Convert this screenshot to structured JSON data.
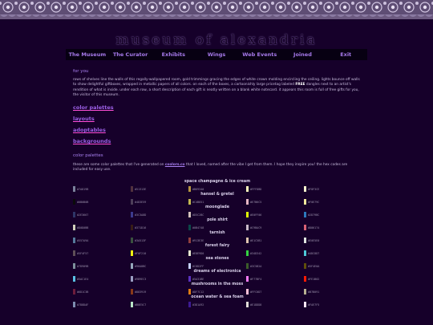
{
  "title": "museum of alexandria",
  "nav": [
    "The Museum",
    "The Curator",
    "Exhibits",
    "Wings",
    "Web Events",
    "Joined",
    "Exit"
  ],
  "intro": {
    "heading": "for you",
    "p1": "rows of shelves line the walls of this regally-wallpapered room, gold trimmings gracing the edges of white crown molding encircling the ceiling. lights bounce off walls to show delightful giftboxes, wrapped in metallic papers of all colors. on each of the boxes, a cartoonishly large pricetag labeled",
    "free": "FREE",
    "p2": "dangles next to an artist's rendition of what is inside. under each row, a short description of each gift is neatly written on a blank white notecard. it appears this room is full of free gifts for you, the visitor of this museum."
  },
  "links": [
    "color palettes",
    "layouts",
    "adoptables",
    "backgrounds"
  ],
  "palettes_section": {
    "heading": "color palettes",
    "text_a": "these are some color palettes that I've generated on",
    "link": "coolors.co",
    "text_b": "that I loved, named after the vibe I get from them. I hope they inspire you! the hex codes are included for easy use."
  },
  "palette_names": [
    "space champagne & ice cream",
    "hansel & gretel",
    "moonglade",
    "pole shirt",
    "tarnish",
    "forest fairy",
    "sea stones",
    "dreams of electronica",
    "mushrooms in the moss",
    "ocean water & sea foam"
  ],
  "swatch_rows": [
    [
      {
        "hex": "#7A819B",
        "c": "#7a819b"
      },
      {
        "hex": "#51313E",
        "c": "#51313e"
      },
      {
        "hex": "#B69340",
        "c": "#b69340"
      },
      {
        "hex": "#FFF8BD",
        "c": "#fff8bd"
      },
      {
        "hex": "#F8F3CE",
        "c": "#f8f3ce"
      }
    ],
    [
      {
        "hex": "#0B0B0B",
        "c": "#0b0b0b"
      },
      {
        "hex": "#4D3E59",
        "c": "#4d3e59"
      },
      {
        "hex": "#C4B851",
        "c": "#c4b851"
      },
      {
        "hex": "#E7B6C5",
        "c": "#e7b6c5"
      },
      {
        "hex": "#F0E79C",
        "c": "#f0e79c"
      }
    ],
    [
      {
        "hex": "#2E3667",
        "c": "#2e3667"
      },
      {
        "hex": "#3C3A8D",
        "c": "#3c3a8d"
      },
      {
        "hex": "#D5C2BC",
        "c": "#d5c2bc"
      },
      {
        "hex": "#E0FF06",
        "c": "#e0ff06"
      },
      {
        "hex": "#2D79BC",
        "c": "#2d79bc"
      }
    ],
    [
      {
        "hex": "#D0D0BB",
        "c": "#d0d0bb"
      },
      {
        "hex": "#371D16",
        "c": "#371d16"
      },
      {
        "hex": "#0B4748",
        "c": "#0b4748"
      },
      {
        "hex": "#C9BAC9",
        "c": "#c9bac9"
      },
      {
        "hex": "#D86174",
        "c": "#d86174"
      }
    ],
    [
      {
        "hex": "#557A9A",
        "c": "#557a9a"
      },
      {
        "hex": "#3A513F",
        "c": "#3a513f"
      },
      {
        "hex": "#913E3E",
        "c": "#913e3e"
      },
      {
        "hex": "#E1C5B1",
        "c": "#e1c5b1"
      },
      {
        "hex": "#E0E5E0",
        "c": "#e0e5e0"
      }
    ],
    [
      {
        "hex": "#5F4F57",
        "c": "#5f4f57"
      },
      {
        "hex": "#F0F210",
        "c": "#f0f210"
      },
      {
        "hex": "#E8E9D0",
        "c": "#e8e9d0"
      },
      {
        "hex": "#34D342",
        "c": "#34d342"
      },
      {
        "hex": "#4DC8D7",
        "c": "#4dc8d7"
      }
    ],
    [
      {
        "hex": "#7D909B",
        "c": "#7d909b"
      },
      {
        "hex": "#96A8BC",
        "c": "#96a8bc"
      },
      {
        "hex": "#C8D2FF",
        "c": "#c8d2ff"
      },
      {
        "hex": "#3C5B2A",
        "c": "#3c5b2a"
      },
      {
        "hex": "#5F4E0A",
        "c": "#5f4e0a"
      }
    ],
    [
      {
        "hex": "#5AC1E4",
        "c": "#5ac1e4"
      },
      {
        "hex": "#9B9EC3",
        "c": "#9b9ec3"
      },
      {
        "hex": "#5A31BE",
        "c": "#5a31be"
      },
      {
        "hex": "#F77BF4",
        "c": "#f77bf4"
      },
      {
        "hex": "#FE1B02",
        "c": "#fe1b02"
      }
    ],
    [
      {
        "hex": "#6D1C3B",
        "c": "#6d1c3b"
      },
      {
        "hex": "#883919",
        "c": "#883919"
      },
      {
        "hex": "#DF7C12",
        "c": "#df7c12"
      },
      {
        "hex": "#FFC0D7",
        "c": "#ffc0d7"
      },
      {
        "hex": "#B7B091",
        "c": "#b7b091"
      }
    ],
    [
      {
        "hex": "#7D8DAF",
        "c": "#7d8daf"
      },
      {
        "hex": "#B8E5C7",
        "c": "#b8e5c7"
      },
      {
        "hex": "#3D1A92",
        "c": "#3d1a92"
      },
      {
        "hex": "#E1DDD8",
        "c": "#e1ddd8"
      },
      {
        "hex": "#FAE7F5",
        "c": "#fae7f5"
      }
    ]
  ]
}
